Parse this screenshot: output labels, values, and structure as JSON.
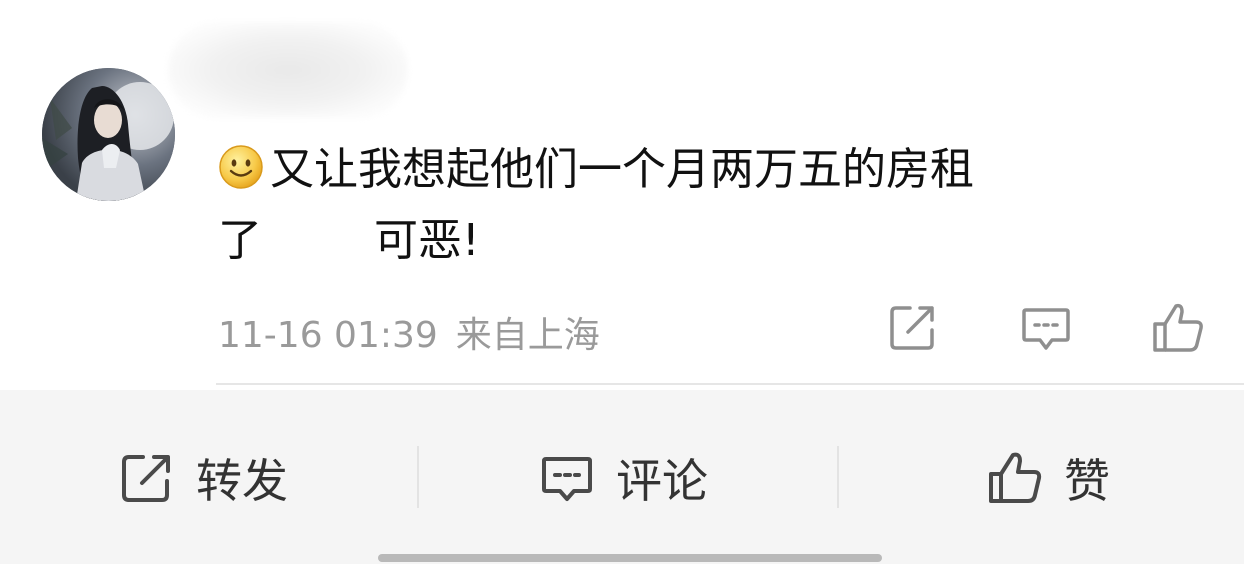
{
  "comment": {
    "text_line1": "又让我想起他们一个月两万五的房租",
    "text_line2_start": "了",
    "text_line2_end": "可恶!",
    "emoji": "smile-emoji",
    "timestamp": "11-16 01:39",
    "location": "来自上海"
  },
  "actions": {
    "share_label": "转发",
    "comment_label": "评论",
    "like_label": "赞"
  },
  "icons": {
    "share": "share-icon",
    "comment": "comment-icon",
    "like": "thumbs-up-icon"
  },
  "colors": {
    "text": "#111111",
    "meta": "#9a9a9a",
    "action_bar_bg": "#f5f5f5",
    "action_text": "#333333"
  }
}
